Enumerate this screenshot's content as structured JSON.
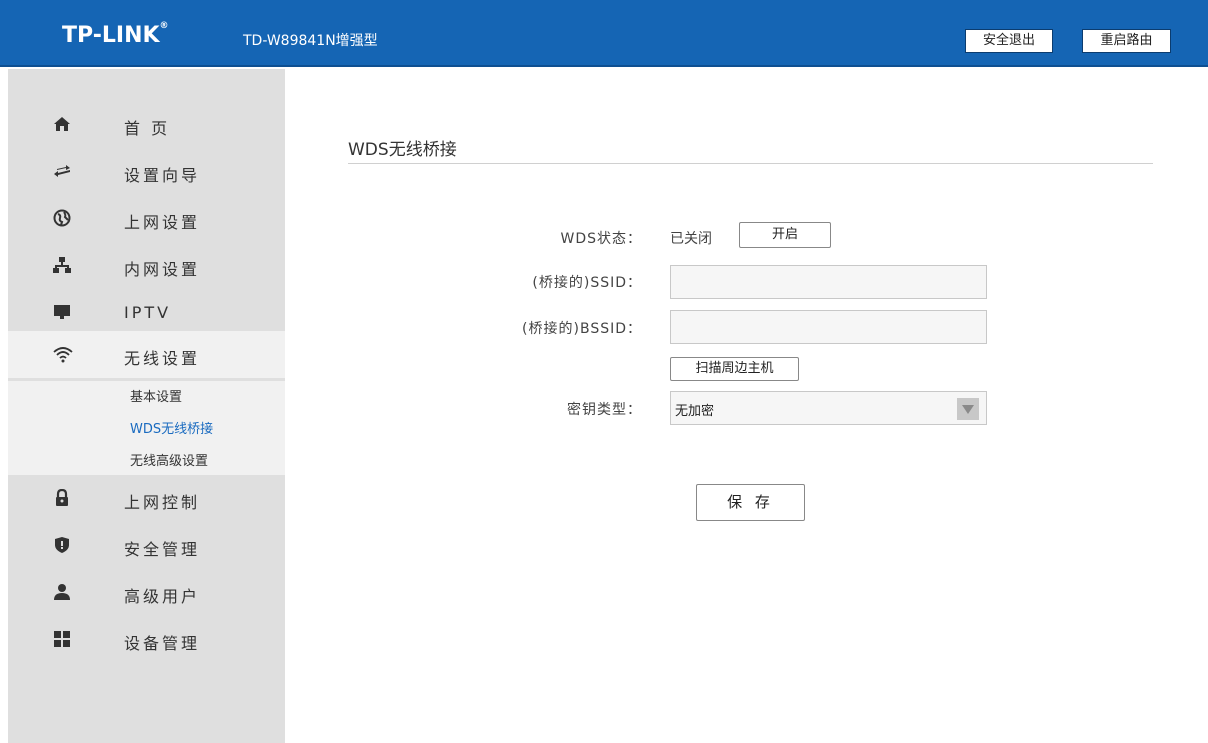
{
  "header": {
    "brand": "TP-LINK",
    "brand_mark": "®",
    "model": "TD-W89841N增强型",
    "logout_label": "安全退出",
    "reboot_label": "重启路由",
    "bg_color": "#1565b4"
  },
  "sidebar": {
    "items": [
      {
        "label": "首 页",
        "icon": "home-icon"
      },
      {
        "label": "设置向导",
        "icon": "arrows-icon"
      },
      {
        "label": "上网设置",
        "icon": "globe-icon"
      },
      {
        "label": "内网设置",
        "icon": "network-icon"
      },
      {
        "label": "IPTV",
        "icon": "monitor-icon"
      },
      {
        "label": "无线设置",
        "icon": "wifi-icon"
      },
      {
        "label": "上网控制",
        "icon": "lock-icon"
      },
      {
        "label": "安全管理",
        "icon": "shield-icon"
      },
      {
        "label": "高级用户",
        "icon": "user-icon"
      },
      {
        "label": "设备管理",
        "icon": "grid-icon"
      }
    ],
    "submenu": [
      "基本设置",
      "WDS无线桥接",
      "无线高级设置"
    ],
    "active_item": "无线设置",
    "active_sub": "WDS无线桥接"
  },
  "main": {
    "title": "WDS无线桥接",
    "status_label": "WDS状态：",
    "status_value": "已关闭",
    "enable_label": "开启",
    "ssid_label": "(桥接的)SSID：",
    "ssid_value": "",
    "bssid_label": "(桥接的)BSSID：",
    "bssid_value": "",
    "scan_label": "扫描周边主机",
    "keytype_label": "密钥类型：",
    "keytype_value": "无加密",
    "save_label": "保 存"
  }
}
